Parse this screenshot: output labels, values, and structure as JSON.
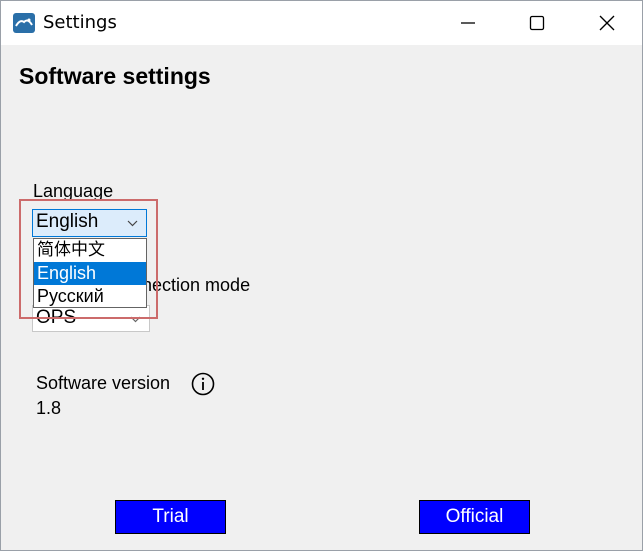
{
  "window": {
    "title": "Settings",
    "icon": "app-logo-icon"
  },
  "titlebar_controls": [
    "minimize-icon",
    "maximize-icon",
    "close-icon"
  ],
  "heading": "Software settings",
  "language": {
    "label": "Language",
    "selected": "English",
    "options": [
      "简体中文",
      "English",
      "Русский"
    ],
    "highlighted_option": "English"
  },
  "connection": {
    "label_visible": "nnection mode",
    "selected": "OPS"
  },
  "software_version": {
    "label": "Software version",
    "value": "1.8",
    "info_icon": "info-icon"
  },
  "buttons": {
    "trial": "Trial",
    "official": "Official"
  },
  "colors": {
    "accent": "#0078d7",
    "action_button": "#0000ff",
    "highlight_box": "#cc6b6b"
  }
}
